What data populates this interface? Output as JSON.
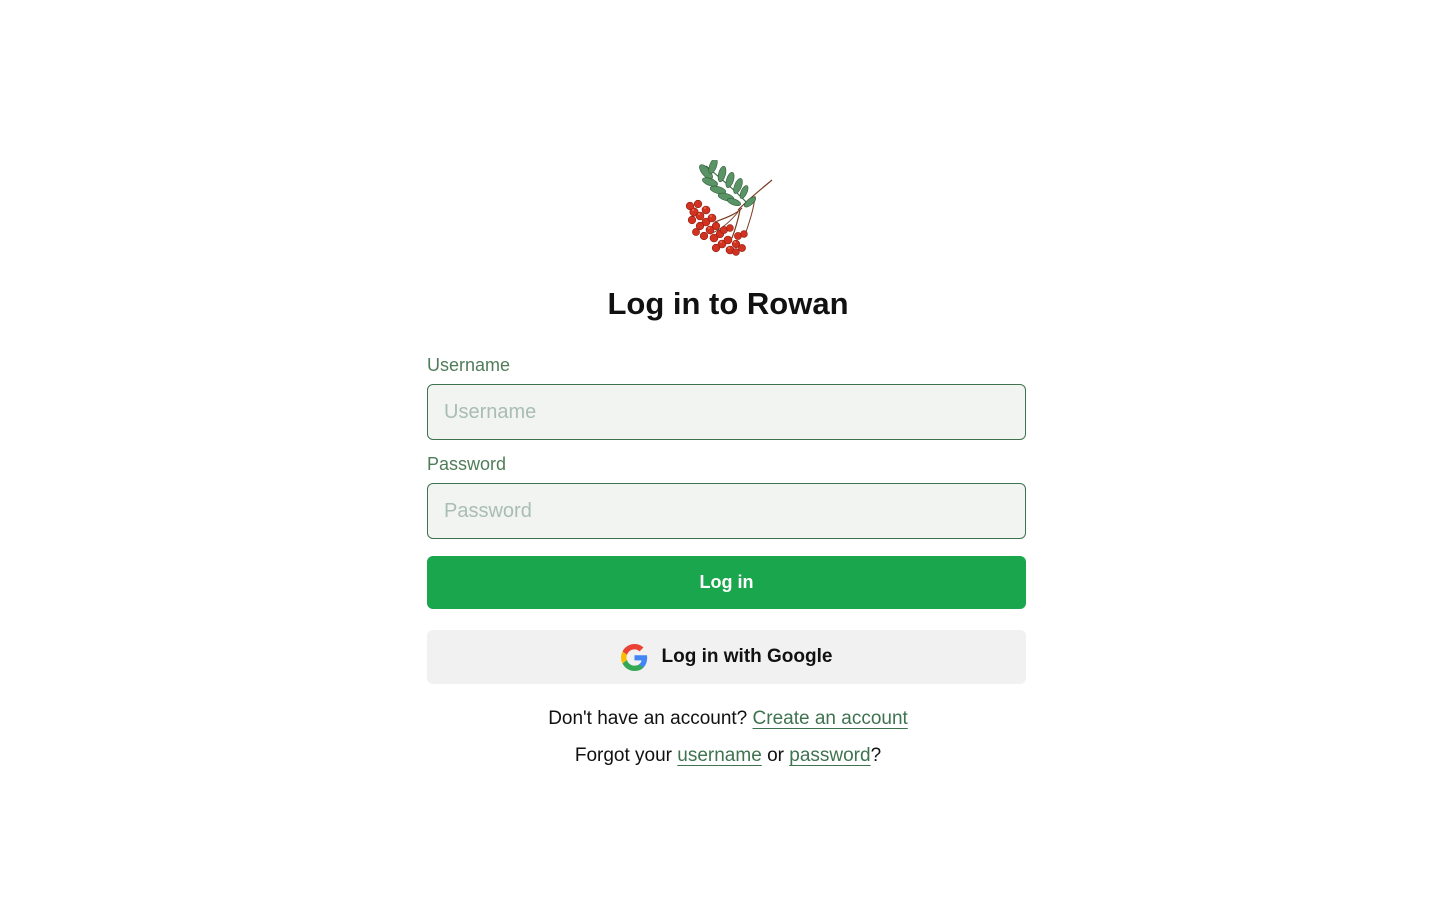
{
  "app": {
    "title": "Log in to Rowan",
    "logo_icon": "rowan-berries-icon"
  },
  "form": {
    "username_label": "Username",
    "username_placeholder": "Username",
    "username_value": "",
    "password_label": "Password",
    "password_placeholder": "Password",
    "password_value": "",
    "login_button_label": "Log in",
    "google_button_label": "Log in with Google",
    "google_icon": "google-icon"
  },
  "footer": {
    "no_account_text": "Don't have an account?",
    "create_account_link": "Create an account",
    "forgot_prefix": "Forgot your",
    "forgot_username_link": "username",
    "forgot_or": "or",
    "forgot_password_link": "password",
    "forgot_suffix": "?"
  },
  "colors": {
    "primary_button": "#19a64d",
    "field_border": "#3f7350",
    "label": "#4f7d59",
    "field_background": "#f2f4f2",
    "google_button_background": "#f1f1f1",
    "berries": "#d2321f",
    "leaves": "#4f8a5b"
  }
}
